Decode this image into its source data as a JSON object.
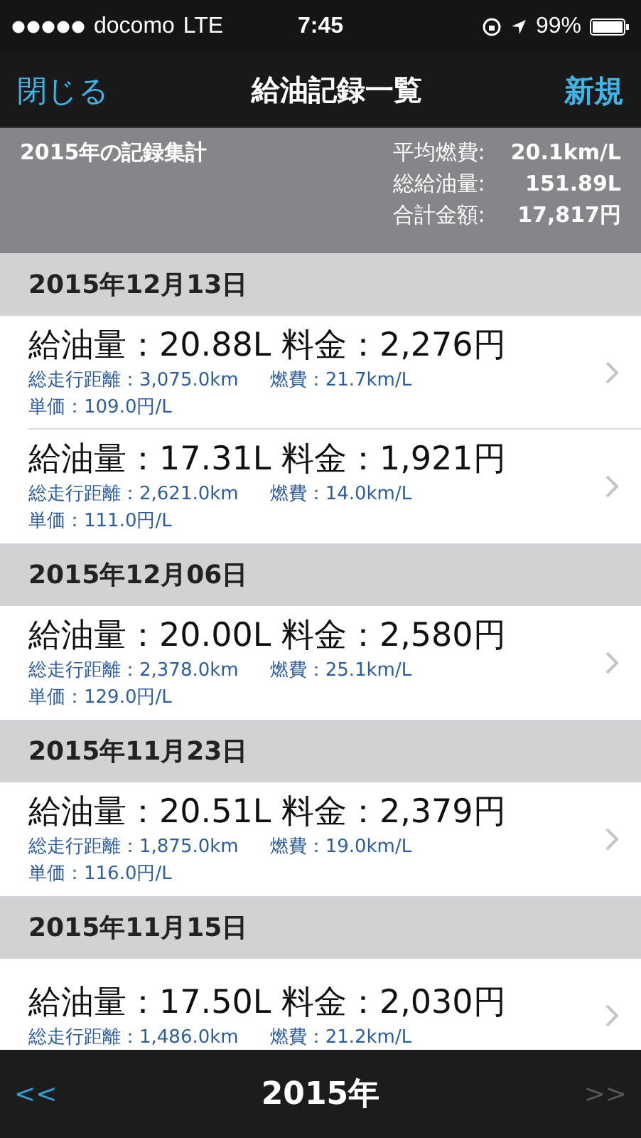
{
  "status_bar": {
    "carrier": "docomo",
    "network": "LTE",
    "time": "7:45",
    "battery": "99%"
  },
  "nav": {
    "left": "閉じる",
    "title": "給油記録一覧",
    "right": "新規"
  },
  "summary": {
    "title": "2015年の記録集計",
    "stats": [
      {
        "label": "平均燃費:",
        "value": "20.1km/L"
      },
      {
        "label": "総給油量:",
        "value": "151.89L"
      },
      {
        "label": "合計金額:",
        "value": "17,817円"
      }
    ]
  },
  "sections": [
    {
      "date": "2015年12月13日",
      "records": [
        {
          "main": "給油量：20.88L 料金：2,276円",
          "distance": "総走行距離：3,075.0km",
          "economy": "燃費：21.7km/L",
          "unit_price": "単価：109.0円/L"
        },
        {
          "main": "給油量：17.31L 料金：1,921円",
          "distance": "総走行距離：2,621.0km",
          "economy": "燃費：14.0km/L",
          "unit_price": "単価：111.0円/L"
        }
      ]
    },
    {
      "date": "2015年12月06日",
      "records": [
        {
          "main": "給油量：20.00L 料金：2,580円",
          "distance": "総走行距離：2,378.0km",
          "economy": "燃費：25.1km/L",
          "unit_price": "単価：129.0円/L"
        }
      ]
    },
    {
      "date": "2015年11月23日",
      "records": [
        {
          "main": "給油量：20.51L 料金：2,379円",
          "distance": "総走行距離：1,875.0km",
          "economy": "燃費：19.0km/L",
          "unit_price": "単価：116.0円/L"
        }
      ]
    },
    {
      "date": "2015年11月15日",
      "records": [
        {
          "main": "給油量：17.50L 料金：2,030円",
          "distance": "総走行距離：1,486.0km",
          "economy": "燃費：21.2km/L"
        }
      ]
    }
  ],
  "footer": {
    "prev": {
      "label": "<<",
      "disabled": false
    },
    "year": "2015年",
    "next": {
      "label": ">>",
      "disabled": true
    }
  }
}
